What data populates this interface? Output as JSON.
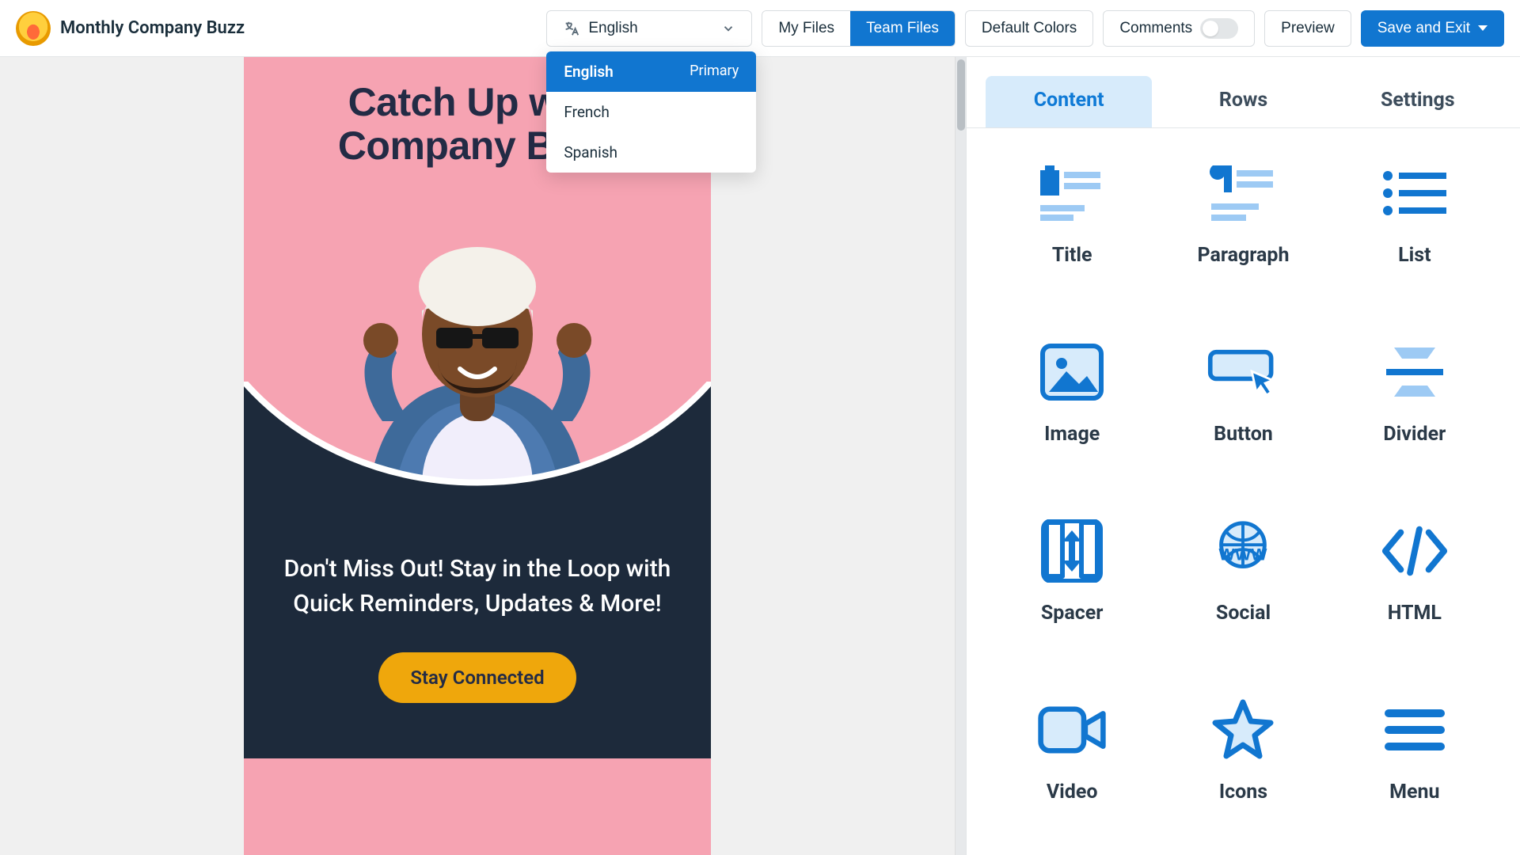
{
  "header": {
    "title": "Monthly Company Buzz",
    "language": "English",
    "language_badge": "Primary",
    "language_options": [
      "English",
      "French",
      "Spanish"
    ],
    "my_files": "My Files",
    "team_files": "Team Files",
    "default_colors": "Default Colors",
    "comments": "Comments",
    "preview": "Preview",
    "save": "Save and Exit"
  },
  "email": {
    "headline": "Catch Up with Company Buzz",
    "subhead": "Don't Miss Out! Stay in the Loop with Quick Reminders, Updates & More!",
    "cta": "Stay Connected"
  },
  "panel": {
    "tabs": {
      "content": "Content",
      "rows": "Rows",
      "settings": "Settings"
    },
    "blocks": [
      {
        "id": "title",
        "label": "Title"
      },
      {
        "id": "paragraph",
        "label": "Paragraph"
      },
      {
        "id": "list",
        "label": "List"
      },
      {
        "id": "image",
        "label": "Image"
      },
      {
        "id": "button",
        "label": "Button"
      },
      {
        "id": "divider",
        "label": "Divider"
      },
      {
        "id": "spacer",
        "label": "Spacer"
      },
      {
        "id": "social",
        "label": "Social"
      },
      {
        "id": "html",
        "label": "HTML"
      },
      {
        "id": "video",
        "label": "Video"
      },
      {
        "id": "icons",
        "label": "Icons"
      },
      {
        "id": "menu",
        "label": "Menu"
      }
    ]
  },
  "colors": {
    "accent": "#1176d0",
    "accent_light": "#9dcaf4",
    "text": "#2b3a48"
  }
}
